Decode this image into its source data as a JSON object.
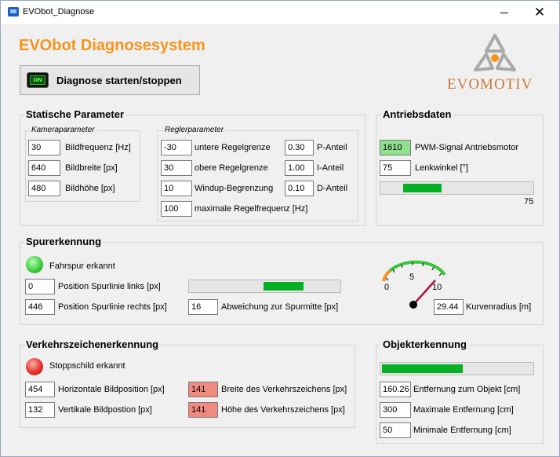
{
  "window": {
    "title": "EVObot_Diagnose"
  },
  "app": {
    "heading": "EVObot Diagnosesystem",
    "start_button": {
      "badge": "ON",
      "label": "Diagnose starten/stoppen"
    },
    "logo_text": "EVOMOTIV"
  },
  "static_params": {
    "title": "Statische Parameter",
    "camera": {
      "title": "Kameraparameter",
      "rows": [
        {
          "value": "30",
          "label": "Bildfrequenz [Hz]"
        },
        {
          "value": "640",
          "label": "Bildbreite [px]"
        },
        {
          "value": "480",
          "label": "Bildhöhe [px]"
        }
      ]
    },
    "controller": {
      "title": "Reglerparameter",
      "limits": [
        {
          "value": "-30",
          "label": "untere Regelgrenze"
        },
        {
          "value": "30",
          "label": "obere Regelgrenze"
        },
        {
          "value": "10",
          "label": "Windup-Begrenzung"
        },
        {
          "value": "100",
          "label": "maximale Regelfrequenz [Hz]"
        }
      ],
      "gains": [
        {
          "value": "0.30",
          "label": "P-Anteil"
        },
        {
          "value": "1.00",
          "label": "I-Anteil"
        },
        {
          "value": "0.10",
          "label": "D-Anteil"
        }
      ]
    }
  },
  "drive": {
    "title": "Antriebsdaten",
    "pwm": {
      "value": "1610",
      "label": "PWM-Signal Antriebsmotor"
    },
    "steering": {
      "value": "75",
      "label": "Lenkwinkel [°]"
    },
    "bar": {
      "value": 75,
      "min": 0,
      "max": 150,
      "display": "75"
    }
  },
  "lane": {
    "title": "Spurerkennung",
    "status": "Fahrspur erkannt",
    "left": {
      "value": "0",
      "label": "Position Spurlinie links [px]"
    },
    "right": {
      "value": "446",
      "label": "Position Spurlinie rechts [px]"
    },
    "deviation": {
      "value": "16",
      "label": "Abweichung zur Spurmitte [px]"
    },
    "deviation_bar": {
      "range_start": 0.49,
      "range_end": 0.76
    },
    "gauge": {
      "ticks": [
        "0",
        "5",
        "10"
      ],
      "needle_value": 10
    },
    "radius": {
      "value": "29.44",
      "label": "Kurvenradius [m]"
    }
  },
  "sign": {
    "title": "Verkehrszeichenerkennung",
    "status": "Stoppschild erkannt",
    "hpos": {
      "value": "454",
      "label": "Horizontale Bildposition [px]"
    },
    "vpos": {
      "value": "132",
      "label": "Vertikale Bildpostion [px]"
    },
    "width": {
      "value": "141",
      "label": "Breite des Verkehrszeichens [px]"
    },
    "height": {
      "value": "141",
      "label": "Höhe des Verkehrszeichens [px]"
    }
  },
  "object": {
    "title": "Objekterkennung",
    "bar": {
      "fraction": 0.54
    },
    "distance": {
      "value": "160.26",
      "label": "Entfernung zum Objekt [cm]"
    },
    "max": {
      "value": "300",
      "label": "Maximale Entfernung [cm]"
    },
    "min": {
      "value": "50",
      "label": "Minimale Entfernung [cm]"
    }
  },
  "colors": {
    "heading": "#f7941d",
    "logo": "#c8793a",
    "progress": "#06b025",
    "led_green": "#3fd13f",
    "led_red": "#e4312a",
    "field_green": "#8ee28e",
    "field_red": "#f08a7e"
  }
}
